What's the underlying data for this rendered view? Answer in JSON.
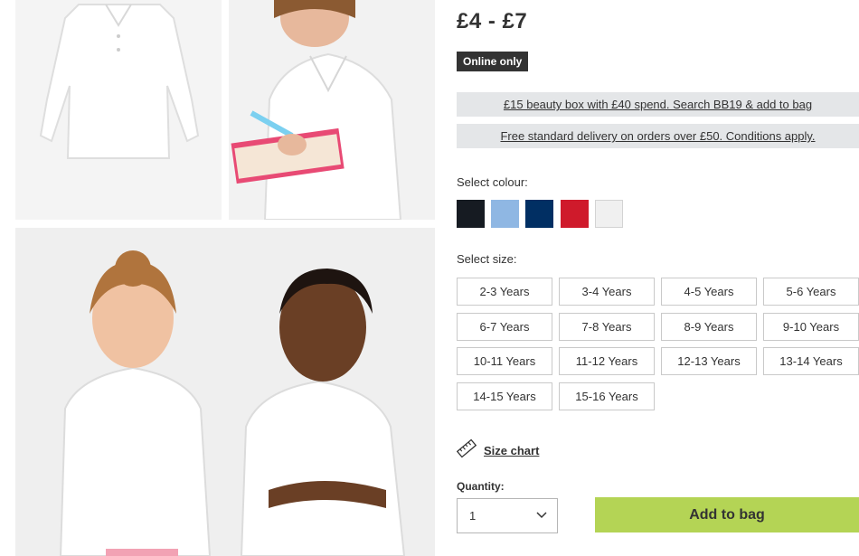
{
  "gallery": {
    "images": [
      {
        "name": "product-image-flat"
      },
      {
        "name": "product-image-girl-notebook"
      },
      {
        "name": "product-image-two-children"
      }
    ]
  },
  "product": {
    "price": "£4 - £7",
    "badge": "Online only"
  },
  "promos": [
    "£15 beauty box with £40 spend. Search BB19 & add to bag",
    "Free standard delivery on orders over £50. Conditions apply."
  ],
  "colour": {
    "label": "Select colour:",
    "swatches": [
      {
        "name": "black",
        "color": "#161b22"
      },
      {
        "name": "light-blue",
        "color": "#8fb7e3"
      },
      {
        "name": "navy",
        "color": "#012f63"
      },
      {
        "name": "red",
        "color": "#cf1a2b"
      },
      {
        "name": "white",
        "color": "#f0f0f0"
      }
    ]
  },
  "size": {
    "label": "Select size:",
    "options": [
      "2-3 Years",
      "3-4 Years",
      "4-5 Years",
      "5-6 Years",
      "6-7 Years",
      "7-8 Years",
      "8-9 Years",
      "9-10 Years",
      "10-11 Years",
      "11-12 Years",
      "12-13 Years",
      "13-14 Years",
      "14-15 Years",
      "15-16 Years"
    ],
    "chart_link": "Size chart"
  },
  "quantity": {
    "label": "Quantity:",
    "value": "1"
  },
  "cart": {
    "add_label": "Add to bag",
    "accent": "#b4d455"
  }
}
